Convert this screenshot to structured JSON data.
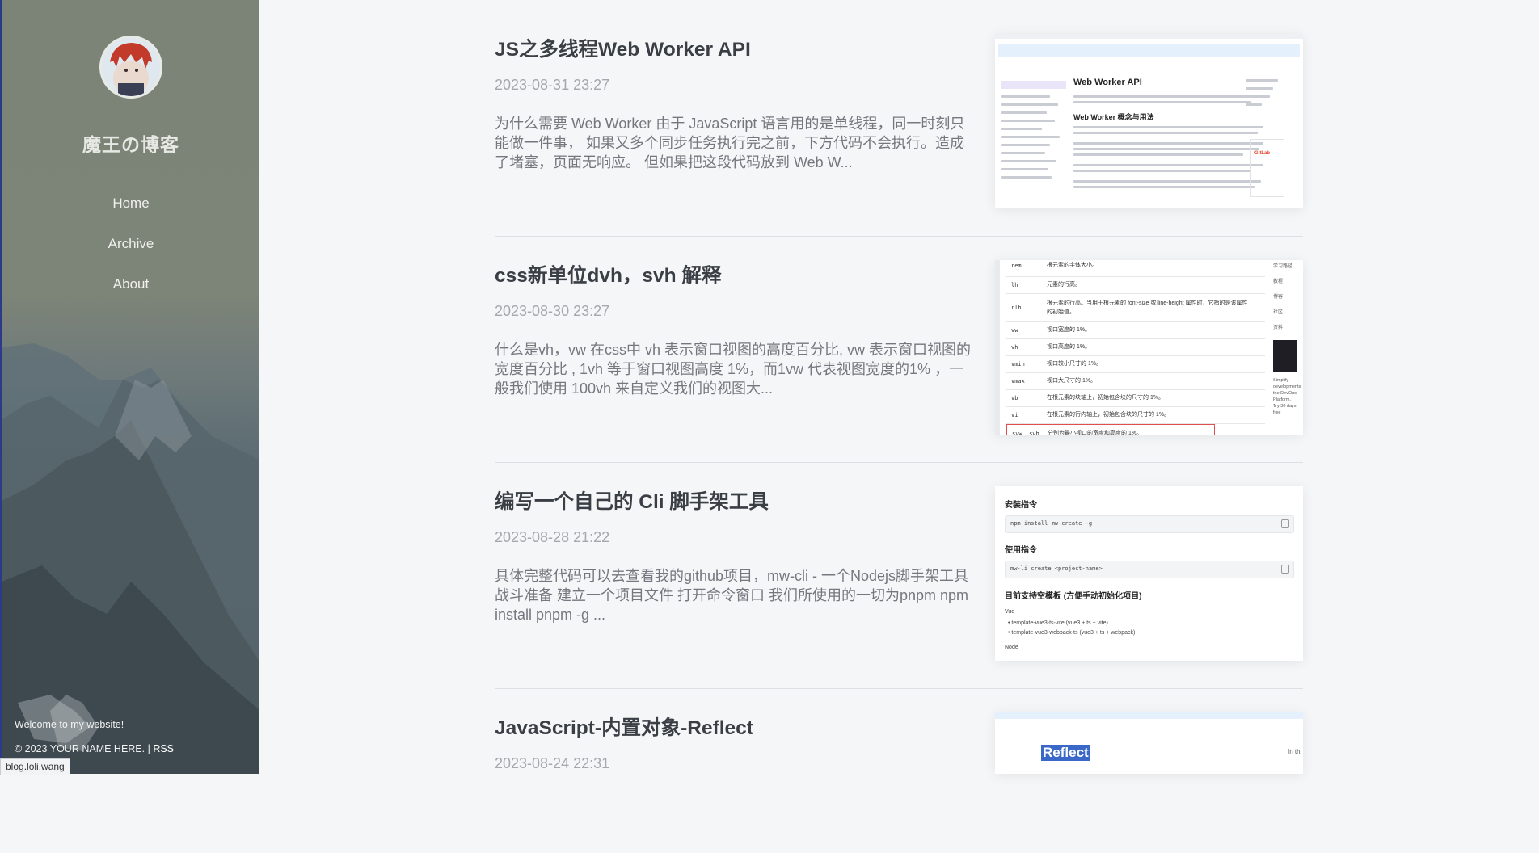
{
  "site": {
    "title": "魔王の博客",
    "nav": [
      "Home",
      "Archive",
      "About"
    ],
    "welcome": "Welcome to my website!",
    "copyright": "© 2023 YOUR NAME HERE. | ",
    "rss": "RSS",
    "status_url": "blog.loli.wang"
  },
  "posts": [
    {
      "title": "JS之多线程Web Worker API",
      "date": "2023-08-31 23:27",
      "excerpt": "为什么需要 Web Worker 由于 JavaScript 语言用的是单线程，同一时刻只能做一件事， 如果又多个同步任务执行完之前，下方代码不会执行。造成了堵塞，页面无响应。 但如果把这段代码放到 Web W...",
      "thumb": {
        "heading": "Web Worker API",
        "subheading": "Web Worker 概念与用法",
        "badge": "GitLab"
      }
    },
    {
      "title": "css新单位dvh，svh 解释",
      "date": "2023-08-30 23:27",
      "excerpt": "什么是vh，vw 在css中 vh 表示窗口视图的高度百分比, vw 表示窗口视图的宽度百分比 , 1vh 等于窗口视图高度 1%，而1vw 代表视图宽度的1% ，一般我们使用 100vh 来自定义我们的视图大...",
      "thumb": {
        "rows": [
          [
            "rem",
            "根元素的字体大小。"
          ],
          [
            "lh",
            "元素的行高。"
          ],
          [
            "rlh",
            "根元素的行高。当用于根元素的 font-size 或 line-height 属性时，它指的是该属性的初始值。"
          ],
          [
            "vw",
            "视口宽度的 1%。"
          ],
          [
            "vh",
            "视口高度的 1%。"
          ],
          [
            "vmin",
            "视口较小尺寸的 1%。"
          ],
          [
            "vmax",
            "视口大尺寸的 1%。"
          ],
          [
            "vb",
            "在根元素的块轴上，初始包含块的尺寸的 1%。"
          ],
          [
            "vi",
            "在根元素的行内轴上，初始包含块的尺寸的 1%。"
          ],
          [
            "svw, svh",
            "分别为最小视口的宽度和高度的 1%。"
          ]
        ],
        "side": [
          "学习路径",
          "教程",
          "博客",
          "社区",
          "资料"
        ],
        "side_note": "Simplify developments the DevOps Platform. Try 30 days free"
      }
    },
    {
      "title": "编写一个自己的 Cli 脚手架工具",
      "date": "2023-08-28 21:22",
      "excerpt": "具体完整代码可以去查看我的github项目，mw-cli - 一个Nodejs脚手架工具 战斗准备 建立一个项目文件 打开命令窗口 我们所使用的一切为pnpm npm install pnpm -g ...",
      "thumb": {
        "install_heading": "安装指令",
        "install_cmd": "npm install mw-create -g",
        "use_heading": "使用指令",
        "use_cmd": "mw-li create <project-name>",
        "templates_heading": "目前支持空模板 (方便手动初始化项目)",
        "vue_label": "Vue",
        "templates": [
          "template-vue3-ts-vite  (vue3 + ts + vite)",
          "template-vue3-webpack-ts  (vue3 + ts + webpack)"
        ],
        "node_label": "Node"
      }
    },
    {
      "title": "JavaScript-内置对象-Reflect",
      "date": "2023-08-24 22:31",
      "excerpt": "",
      "thumb": {
        "highlight": "Reflect",
        "side": "In th"
      }
    }
  ],
  "colors": {
    "page_bg": "#f5f6f8",
    "title": "#3a3f45",
    "date": "#a5a8ac",
    "excerpt": "#74787e",
    "sidebar_text": "#e6e8e4"
  }
}
